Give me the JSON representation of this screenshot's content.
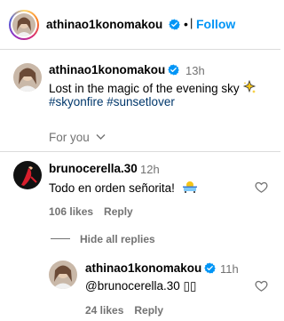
{
  "header": {
    "username": "athinao1konomakou",
    "separator": "•",
    "follow_label": "Follow"
  },
  "caption": {
    "username": "athinao1konomakou",
    "time": "13h",
    "text": "Lost in the magic of the evening sky",
    "emoji": "sparkle-star",
    "hashtags": "#skyonfire #sunsetlover"
  },
  "for_you": {
    "label": "For you"
  },
  "comments": [
    {
      "username": "brunocerella.30",
      "time": "12h",
      "text": "Todo en orden señorita!",
      "emoji": "person-in-bathtub",
      "likes": "106 likes",
      "reply_label": "Reply"
    }
  ],
  "hide_replies": {
    "label": "Hide all replies"
  },
  "replies": [
    {
      "username": "athinao1konomakou",
      "time": "11h",
      "text": "@brunocerella.30 ▯▯",
      "likes": "24 likes",
      "reply_label": "Reply"
    }
  ],
  "colors": {
    "link": "#0095f6",
    "hashtag": "#00376b",
    "muted": "#737373",
    "verified": "#0095f6",
    "divider": "#dbdbdb"
  }
}
